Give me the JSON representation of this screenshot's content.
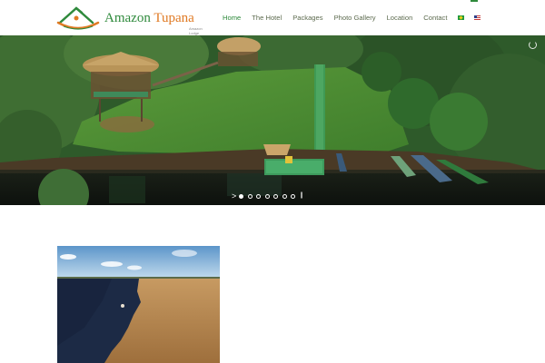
{
  "site": {
    "logo": {
      "word1": "Amazon",
      "word2": "Tupana",
      "tagline": "Amazon Lodge"
    }
  },
  "nav": {
    "items": [
      {
        "label": "Home",
        "active": true
      },
      {
        "label": "The Hotel"
      },
      {
        "label": "Packages"
      },
      {
        "label": "Photo Gallery"
      },
      {
        "label": "Location"
      },
      {
        "label": "Contact"
      }
    ],
    "languages": [
      "brazil-flag-icon",
      "usa-flag-icon"
    ]
  },
  "slider": {
    "slide_count": 7,
    "active_slide": 1,
    "controls": {
      "prev_arrow": ">",
      "pause": "||"
    }
  },
  "colors": {
    "brand_green": "#2f8a3c",
    "brand_orange": "#e07a24",
    "nav_text": "#5d6b4f"
  }
}
